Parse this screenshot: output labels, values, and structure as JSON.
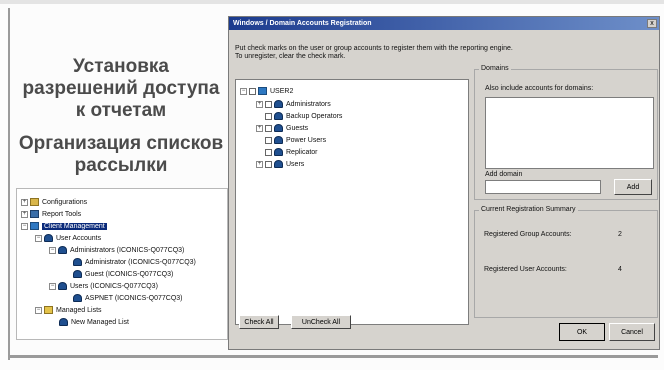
{
  "slide": {
    "heading_1": "Установка разрешений доступа к отчетам",
    "heading_2": "Организация списков рассылки"
  },
  "left_tree": {
    "items": [
      {
        "label": "Configurations",
        "expander": "+",
        "icon": "folder-icon"
      },
      {
        "label": "Report Tools",
        "expander": "+",
        "icon": "tools-icon"
      },
      {
        "label": "Client Management",
        "expander": "−",
        "icon": "client-management-icon"
      },
      {
        "label": "User Accounts",
        "expander": "−",
        "icon": "user-accounts-icon"
      },
      {
        "label": "Administrators (ICONICS-Q077CQ3)",
        "expander": "−",
        "icon": "group-icon"
      },
      {
        "label": "Administrator (ICONICS-Q077CQ3)",
        "expander": "",
        "icon": "user-icon"
      },
      {
        "label": "Guest (ICONICS-Q077CQ3)",
        "expander": "",
        "icon": "user-icon"
      },
      {
        "label": "Users (ICONICS-Q077CQ3)",
        "expander": "−",
        "icon": "group-icon"
      },
      {
        "label": "ASPNET (ICONICS-Q077CQ3)",
        "expander": "",
        "icon": "user-icon"
      },
      {
        "label": "Managed Lists",
        "expander": "−",
        "icon": "list-folder-icon"
      },
      {
        "label": "New Managed List",
        "expander": "",
        "icon": "user-icon"
      }
    ]
  },
  "dialog": {
    "title": "Windows / Domain Accounts Registration",
    "close_label": "x",
    "instruction_line_1": "Put check marks on the user or group accounts to register them with the reporting engine.",
    "instruction_line_2": "To unregister, clear the check mark.",
    "accounts_tree": {
      "root": "USER2",
      "items": [
        "Administrators",
        "Backup Operators",
        "Guests",
        "Power Users",
        "Replicator",
        "Users"
      ]
    },
    "domains": {
      "title": "Domains",
      "also_include_label": "Also include accounts for domains:",
      "add_domain_label": "Add domain",
      "add_domain_value": "",
      "add_button": "Add"
    },
    "summary": {
      "title": "Current Registration Summary",
      "group_label": "Registered Group Accounts:",
      "group_value": "2",
      "user_label": "Registered User Accounts:",
      "user_value": "4"
    },
    "buttons": {
      "check_all": "Check All",
      "uncheck_all": "UnCheck All",
      "ok": "OK",
      "cancel": "Cancel"
    }
  }
}
